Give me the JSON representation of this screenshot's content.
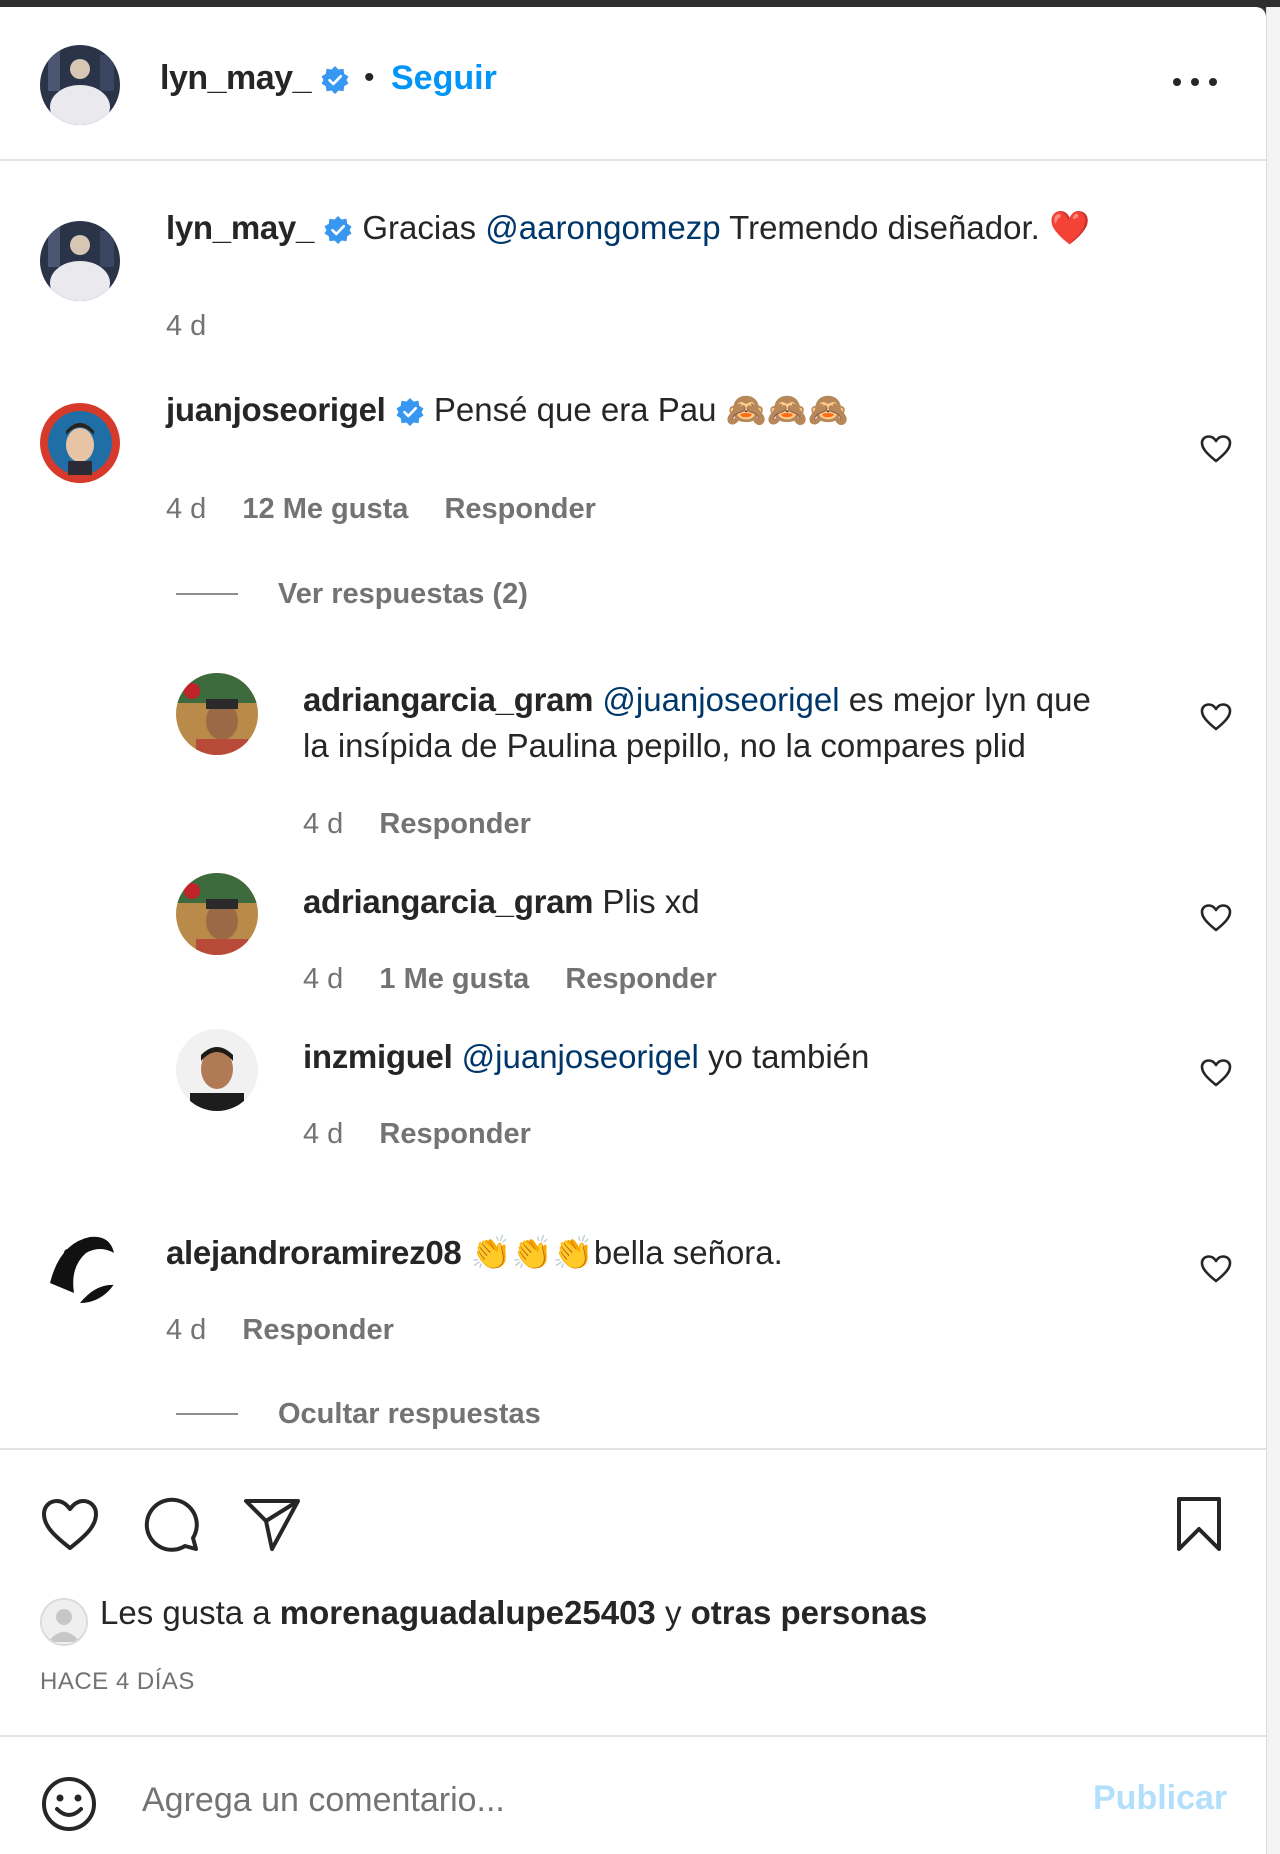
{
  "post": {
    "author": "lyn_may_",
    "follow_label": "Seguir",
    "separator": "•"
  },
  "caption": {
    "user": "lyn_may_",
    "text_before": "Gracias",
    "mention": "@aarongomezp",
    "text_after": "Tremendo diseñador. ❤️",
    "time": "4 d"
  },
  "comments": [
    {
      "user": "juanjoseorigel",
      "verified": true,
      "text": "Pensé que era Pau 🙈🙈🙈",
      "time": "4 d",
      "likes": "12 Me gusta",
      "reply": "Responder",
      "view_replies": "Ver respuestas (2)"
    },
    {
      "user": "alejandroramirez08",
      "verified": false,
      "text": "👏👏👏bella señora.",
      "time": "4 d",
      "reply": "Responder",
      "hide_replies": "Ocultar respuestas"
    }
  ],
  "replies": [
    {
      "user": "adriangarcia_gram",
      "mention": "@juanjoseorigel",
      "text_line1": "es mejor lyn que",
      "text_line2": "la insípida de Paulina pepillo, no la compares plid",
      "time": "4 d",
      "reply": "Responder"
    },
    {
      "user": "adriangarcia_gram",
      "text": "Plis xd",
      "time": "4 d",
      "likes": "1 Me gusta",
      "reply": "Responder"
    },
    {
      "user": "inzmiguel",
      "mention": "@juanjoseorigel",
      "text": "yo también",
      "time": "4 d",
      "reply": "Responder"
    }
  ],
  "likes_summary": {
    "prefix": "Les gusta a",
    "user": "morenaguadalupe25403",
    "connector": "y",
    "others": "otras personas"
  },
  "date": "HACE 4 DÍAS",
  "composer": {
    "placeholder": "Agrega un comentario...",
    "publish_label": "Publicar"
  },
  "icons": {
    "verified": "verified-badge-icon",
    "more": "more-options-icon",
    "heart": "heart-icon",
    "comment": "comment-icon",
    "share": "share-icon",
    "save": "bookmark-icon",
    "emoji": "emoji-icon"
  },
  "colors": {
    "accent": "#0095f6",
    "verified": "#3897f0",
    "mention": "#00376b",
    "secondary_text": "#737373",
    "publish_disabled": "#b2dffc"
  }
}
